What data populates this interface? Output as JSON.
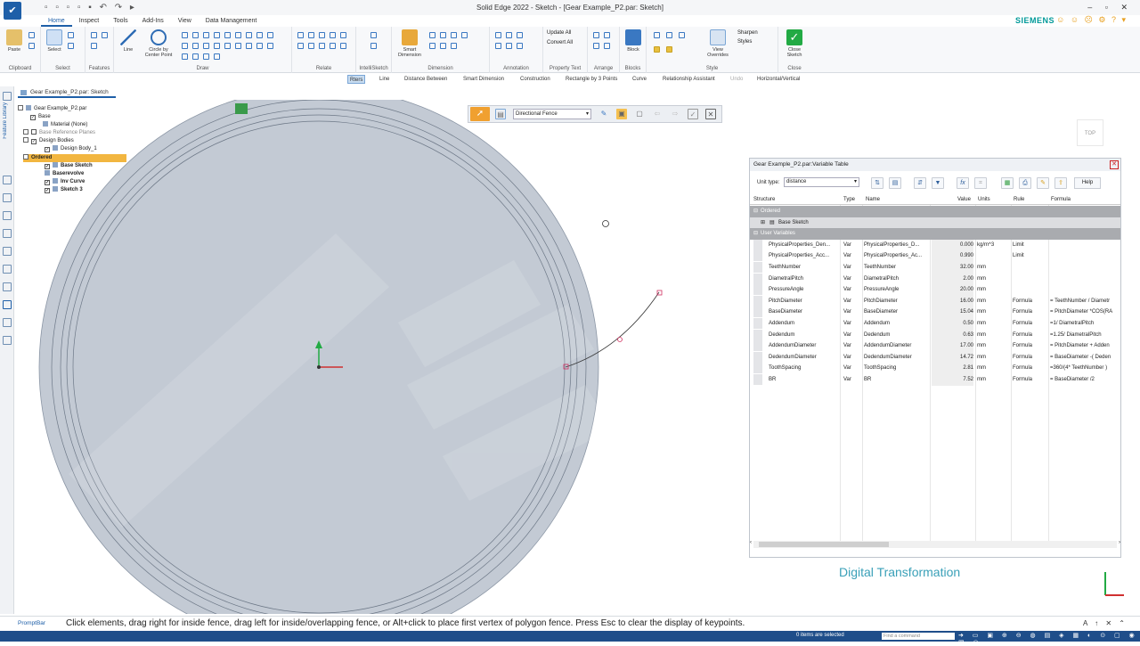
{
  "window": {
    "title": "Solid Edge 2022 - Sketch - [Gear Example_P2.par: Sketch]",
    "controls": [
      "–",
      "▫",
      "✕"
    ]
  },
  "ribbon": {
    "tabs": [
      "Home",
      "Inspect",
      "Tools",
      "Add-Ins",
      "View",
      "Data Management"
    ],
    "active_tab": "Home",
    "brand": "SIEMENS",
    "groups": [
      {
        "label": "Clipboard"
      },
      {
        "label": "Select"
      },
      {
        "label": "Features"
      },
      {
        "label": "Draw"
      },
      {
        "label": "Relate"
      },
      {
        "label": "IntelliSketch"
      },
      {
        "label": "Dimension"
      },
      {
        "label": "Annotation"
      },
      {
        "label": "Property Text"
      },
      {
        "label": "Arrange"
      },
      {
        "label": "Blocks"
      },
      {
        "label": "Style"
      },
      {
        "label": "Close"
      }
    ],
    "buttons": {
      "paste": "Paste",
      "select": "Select",
      "line": "Line",
      "circle": "Circle by Center Point",
      "smart_dimension": "Smart Dimension",
      "update_all": "Update All",
      "convert_all": "Convert All",
      "block": "Block",
      "view_overrides": "View Overrides",
      "sharpen": "Sharpen",
      "styles": "Styles",
      "close_sketch": "Close Sketch"
    }
  },
  "command_bar": {
    "items": [
      "Rters",
      "Line",
      "Distance Between",
      "Smart Dimension",
      "Construction",
      "Rectangle by 3 Points",
      "Curve",
      "Relationship Assistant",
      "Undo",
      "Horizontal/Vertical"
    ]
  },
  "left_strip": {
    "label": "Feature Library"
  },
  "document_tab": {
    "label": "Gear Example_P2.par: Sketch"
  },
  "tree": {
    "root": "Gear Example_P2.par",
    "items": [
      {
        "label": "Base",
        "indent": 2
      },
      {
        "label": "Material (None)",
        "indent": 3
      },
      {
        "label": "Base Reference Planes",
        "indent": 2
      },
      {
        "label": "Design Bodies",
        "indent": 2
      },
      {
        "label": "Design Body_1",
        "indent": 3
      },
      {
        "label": "Ordered",
        "indent": 1
      },
      {
        "label": "Base Sketch",
        "indent": 3
      },
      {
        "label": "Baserevolve",
        "indent": 3
      },
      {
        "label": "Inv Curve",
        "indent": 3
      },
      {
        "label": "Sketch 3",
        "indent": 3
      }
    ]
  },
  "selection_toolbar": {
    "mode": "Directional Fence"
  },
  "variable_table": {
    "title": "Gear Example_P2.par:Variable Table",
    "unit_type_label": "Unit type:",
    "unit_type_value": "distance",
    "help": "Help",
    "columns": [
      "Structure",
      "Type",
      "Name",
      "Value",
      "Units",
      "Rule",
      "Formula"
    ],
    "sections": {
      "ordered": "Ordered",
      "base_sketch": "Base Sketch",
      "user_variables": "User Variables"
    },
    "rows": [
      {
        "structure": "PhysicalProperties_Den...",
        "type": "Var",
        "name": "PhysicalProperties_D...",
        "value": "0.000",
        "units": "kg/m^3",
        "rule": "Limit",
        "formula": ""
      },
      {
        "structure": "PhysicalProperties_Acc...",
        "type": "Var",
        "name": "PhysicalProperties_Ac...",
        "value": "0.990",
        "units": "",
        "rule": "Limit",
        "formula": ""
      },
      {
        "structure": "TeethNumber",
        "type": "Var",
        "name": "TeethNumber",
        "value": "32.00",
        "units": "mm",
        "rule": "",
        "formula": ""
      },
      {
        "structure": "DiametralPitch",
        "type": "Var",
        "name": "DiametralPitch",
        "value": "2.00",
        "units": "mm",
        "rule": "",
        "formula": ""
      },
      {
        "structure": "PressureAngle",
        "type": "Var",
        "name": "PressureAngle",
        "value": "20.00",
        "units": "mm",
        "rule": "",
        "formula": ""
      },
      {
        "structure": "PitchDiameter",
        "type": "Var",
        "name": "PitchDiameter",
        "value": "16.00",
        "units": "mm",
        "rule": "Formula",
        "formula": "= TeethNumber / Diametr"
      },
      {
        "structure": "BaseDiameter",
        "type": "Var",
        "name": "BaseDiameter",
        "value": "15.04",
        "units": "mm",
        "rule": "Formula",
        "formula": "= PitchDiameter *COS(RA"
      },
      {
        "structure": "Addendum",
        "type": "Var",
        "name": "Addendum",
        "value": "0.50",
        "units": "mm",
        "rule": "Formula",
        "formula": "=1/ DiametralPitch"
      },
      {
        "structure": "Dedendum",
        "type": "Var",
        "name": "Dedendum",
        "value": "0.63",
        "units": "mm",
        "rule": "Formula",
        "formula": "=1.25/ DiametralPitch"
      },
      {
        "structure": "AddendumDiameter",
        "type": "Var",
        "name": "AddendumDiameter",
        "value": "17.00",
        "units": "mm",
        "rule": "Formula",
        "formula": "= PitchDiameter + Adden"
      },
      {
        "structure": "DedendumDiameter",
        "type": "Var",
        "name": "DedendumDiameter",
        "value": "14.72",
        "units": "mm",
        "rule": "Formula",
        "formula": "= BaseDiameter -( Deden"
      },
      {
        "structure": "ToothSpacing",
        "type": "Var",
        "name": "ToothSpacing",
        "value": "2.81",
        "units": "mm",
        "rule": "Formula",
        "formula": "=360/(4* TeethNumber )"
      },
      {
        "structure": "BR",
        "type": "Var",
        "name": "BR",
        "value": "7.52",
        "units": "mm",
        "rule": "Formula",
        "formula": "= BaseDiameter /2"
      }
    ]
  },
  "overlay_text": "Digital Transformation",
  "view_cube_label": "TOP",
  "prompt_bar": {
    "label": "PromptBar",
    "text": "Click elements, drag right for inside fence, drag left for inside/overlapping fence, or Alt+click to place first vertex of polygon fence. Press Esc to clear the display of keypoints."
  },
  "status_bar": {
    "text": "0 items are selected",
    "find_placeholder": "Find a command"
  },
  "colors": {
    "accent": "#1e5fa8",
    "brand": "#009999",
    "gear_fill": "#c5ccd6",
    "close_sketch": "#22aa44"
  }
}
